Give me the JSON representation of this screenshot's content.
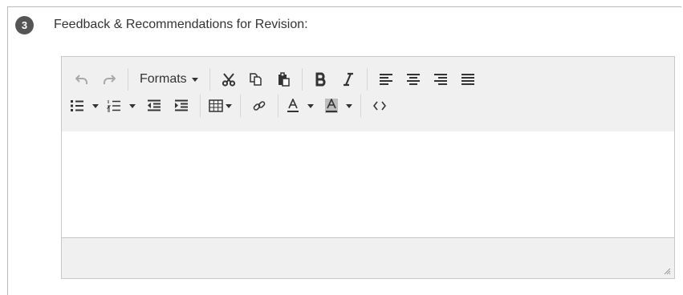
{
  "section": {
    "step_number": "3",
    "label": "Feedback & Recommendations for Revision:"
  },
  "toolbar": {
    "formats_label": "Formats",
    "row1": [
      "undo-icon",
      "redo-icon",
      "formats-dropdown",
      "cut-icon",
      "copy-icon",
      "paste-icon",
      "bold-icon",
      "italic-icon",
      "align-left-icon",
      "align-center-icon",
      "align-right-icon",
      "align-justify-icon"
    ],
    "row2": [
      "bullet-list-icon",
      "numbered-list-icon",
      "outdent-icon",
      "indent-icon",
      "table-icon",
      "link-icon",
      "text-color-icon",
      "background-color-icon",
      "source-code-icon"
    ]
  },
  "colors": {
    "badge": "#555555",
    "toolbar_bg": "#f0f0f0",
    "border": "#c8c8c8",
    "disabled_icon": "#a8a8a8"
  }
}
